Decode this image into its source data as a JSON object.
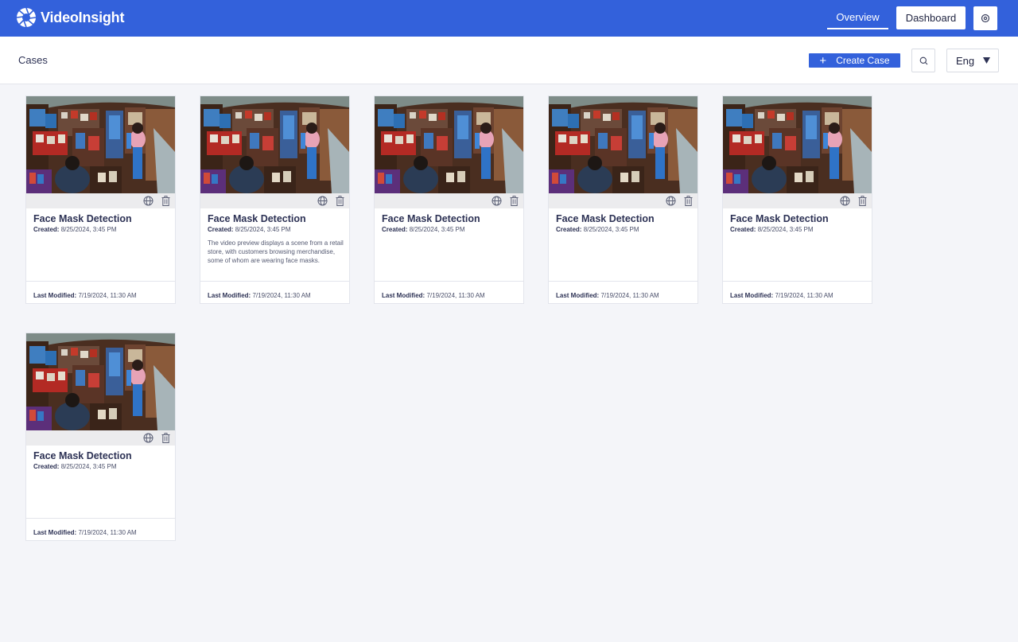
{
  "app": {
    "name": "VideoInsight"
  },
  "nav": {
    "overview": "Overview",
    "dashboard": "Dashboard"
  },
  "page": {
    "title": "Cases",
    "create_label": "Create Case",
    "language": "Eng"
  },
  "icons": {
    "settings": "settings-icon",
    "search": "search-icon",
    "globe": "globe-icon",
    "trash": "trash-icon",
    "caret": "caret-down-icon"
  },
  "colors": {
    "brand": "#3361db",
    "background": "#f4f5f9"
  },
  "cases": [
    {
      "title": "Face Mask Detection",
      "created_label": "Created:",
      "created": "8/25/2024, 3:45 PM",
      "description": "",
      "modified_label": "Last Modified:",
      "modified": "7/19/2024, 11:30 AM"
    },
    {
      "title": "Face Mask Detection",
      "created_label": "Created:",
      "created": "8/25/2024, 3:45 PM",
      "description": "The video preview displays a scene from a retail store, with customers browsing merchandise, some of whom are wearing face masks.",
      "modified_label": "Last Modified:",
      "modified": "7/19/2024, 11:30 AM"
    },
    {
      "title": "Face Mask Detection",
      "created_label": "Created:",
      "created": "8/25/2024, 3:45 PM",
      "description": "",
      "modified_label": "Last Modified:",
      "modified": "7/19/2024, 11:30 AM"
    },
    {
      "title": "Face Mask Detection",
      "created_label": "Created:",
      "created": "8/25/2024, 3:45 PM",
      "description": "",
      "modified_label": "Last Modified:",
      "modified": "7/19/2024, 11:30 AM"
    },
    {
      "title": "Face Mask Detection",
      "created_label": "Created:",
      "created": "8/25/2024, 3:45 PM",
      "description": "",
      "modified_label": "Last Modified:",
      "modified": "7/19/2024, 11:30 AM"
    },
    {
      "title": "Face Mask Detection",
      "created_label": "Created:",
      "created": "8/25/2024, 3:45 PM",
      "description": "",
      "modified_label": "Last Modified:",
      "modified": "7/19/2024, 11:30 AM"
    }
  ]
}
